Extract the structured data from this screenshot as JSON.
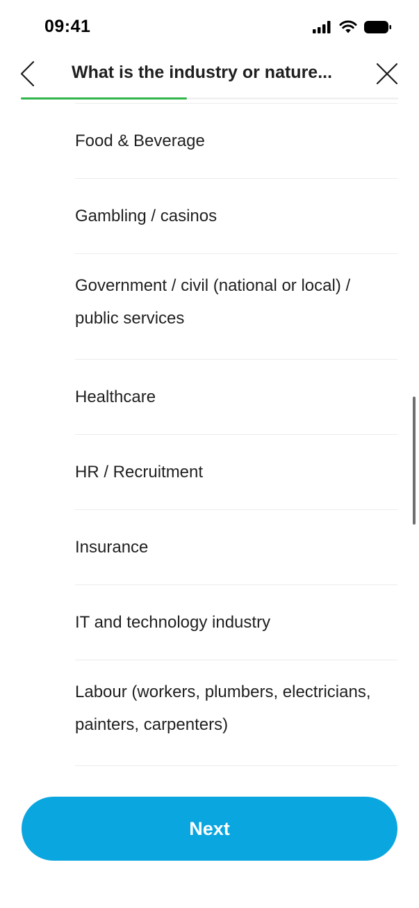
{
  "status_bar": {
    "time": "09:41",
    "icons": [
      "signal-icon",
      "wifi-icon",
      "battery-icon"
    ]
  },
  "header": {
    "title": "What is the industry or nature...",
    "back_icon": "chevron-left-icon",
    "close_icon": "close-icon",
    "progress_fraction": 0.44,
    "progress_color": "#2fb54a"
  },
  "options": [
    {
      "label": "Food & Beverage"
    },
    {
      "label": "Gambling / casinos"
    },
    {
      "label": "Government / civil (national or local) / public services"
    },
    {
      "label": "Healthcare"
    },
    {
      "label": "HR / Recruitment"
    },
    {
      "label": "Insurance"
    },
    {
      "label": "IT and technology industry"
    },
    {
      "label": "Labour (workers, plumbers, electricians, painters, carpenters)"
    }
  ],
  "footer": {
    "next_label": "Next",
    "button_color": "#0aa6df"
  }
}
